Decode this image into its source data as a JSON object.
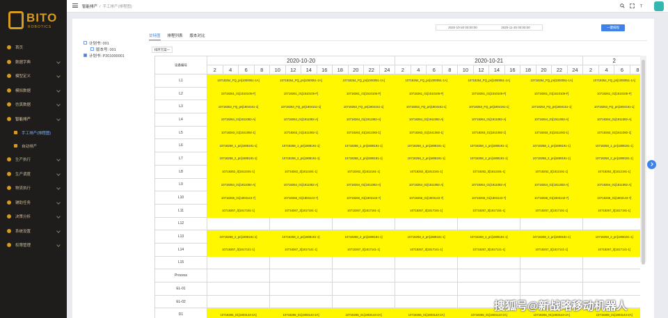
{
  "brand": {
    "name": "BITO",
    "tagline": "ROBOTICS"
  },
  "nav": [
    {
      "label": "首页",
      "icon": "home-icon"
    },
    {
      "label": "数据字典",
      "icon": "dictionary-icon"
    },
    {
      "label": "模型定义",
      "icon": "model-icon"
    },
    {
      "label": "模拟数据",
      "icon": "mock-icon"
    },
    {
      "label": "仿真数据",
      "icon": "simulation-icon"
    },
    {
      "label": "智能排产",
      "icon": "schedule-icon",
      "active": true
    },
    {
      "label": "手工排产(排程图)",
      "sub": true,
      "active": true
    },
    {
      "label": "自动排产",
      "sub": true
    },
    {
      "label": "生产执行",
      "icon": "execution-icon"
    },
    {
      "label": "生产调度",
      "icon": "dispatch-icon"
    },
    {
      "label": "物流执行",
      "icon": "logistics-icon"
    },
    {
      "label": "辅助任务",
      "icon": "task-icon"
    },
    {
      "label": "决策分析",
      "icon": "analysis-icon"
    },
    {
      "label": "系统设置",
      "icon": "settings-icon"
    },
    {
      "label": "权限管理",
      "icon": "permission-icon"
    }
  ],
  "breadcrumb": {
    "parent": "智能排产",
    "current": "手工排产(排程图)"
  },
  "tree": {
    "root": "计划书: 001",
    "child": "版本号: 001",
    "second": "计划书: P201000001"
  },
  "dates": {
    "start": "2020-10-20 00:00:00",
    "end": "2020-11-30 00:00:00"
  },
  "query_label": "一键排程",
  "tabs": [
    "甘特图",
    "排程列表",
    "版本对比"
  ],
  "subtab": "排序方案一",
  "grid": {
    "device_header": "设备编号",
    "days": [
      "2020-10-20",
      "2020-10-21",
      "2"
    ],
    "hours": [
      "2",
      "4",
      "6",
      "8",
      "10",
      "12",
      "14",
      "16",
      "18",
      "20",
      "22",
      "24",
      "2",
      "4",
      "6",
      "8",
      "10",
      "12",
      "14",
      "16",
      "18",
      "20",
      "22",
      "24",
      "2",
      "4",
      "6",
      "8"
    ],
    "rows": [
      {
        "label": "L1",
        "text": "10718254_FQ_pn[1000051-1A]",
        "pat": "yyyyyyyygg"
      },
      {
        "label": "L2",
        "text": "10718261_01[1510105-F]",
        "pat": "yyyyyyyygg"
      },
      {
        "label": "L3",
        "text": "10718253_FQ_pn[1804161-1]",
        "pat": "yyyyyyyygg"
      },
      {
        "label": "L4",
        "text": "10718264_01[1911082-A]",
        "pat": "yyyyyyyygg"
      },
      {
        "label": "L5",
        "text": "10718263_01[1611082-1]",
        "pat": "yyyyyyyygg"
      },
      {
        "label": "L6",
        "text": "10718258_1_pn[1808191-1]",
        "pat": "yyyyyyyygg"
      },
      {
        "label": "L7",
        "text": "10718258_2_pn[1808191-1]",
        "pat": "yyyyyyyygg"
      },
      {
        "label": "L8",
        "text": "10718262_0[1812191-1]",
        "pat": "yyyyyyyygg"
      },
      {
        "label": "L9",
        "text": "10718264_01[1811082-A]",
        "pat": "yyyyyyyygg"
      },
      {
        "label": "L10",
        "text": "10718266_01[1803143-7]",
        "pat": "yyyyyyyygg"
      },
      {
        "label": "L11",
        "text": "10718267_0[1817191-1]",
        "pat": "yyyyyyyygg"
      },
      {
        "label": "L12",
        "text": "",
        "pat": "wwwwwwwwww"
      },
      {
        "label": "L13",
        "text": "10718258_2_pn[1808181-1]",
        "pat": "yyyyyyyygg"
      },
      {
        "label": "L14",
        "text": "10718267_0[1817141-1]",
        "pat": "yyyyyyyygg"
      },
      {
        "label": "L15",
        "text": "",
        "pat": "wwwwwwwwww"
      },
      {
        "label": "Process",
        "text": "",
        "pat": "wwwwwwwwww"
      },
      {
        "label": "EL-01",
        "text": "",
        "pat": "wwwwwwwwww"
      },
      {
        "label": "EL-02",
        "text": "",
        "pat": "wwwwwwwwww"
      },
      {
        "label": "D1",
        "text": "10718265_01[1803143-2A]",
        "pat": "yyyyyyyyyy"
      }
    ]
  },
  "watermark": "搜狐号@新战略移动机器人"
}
